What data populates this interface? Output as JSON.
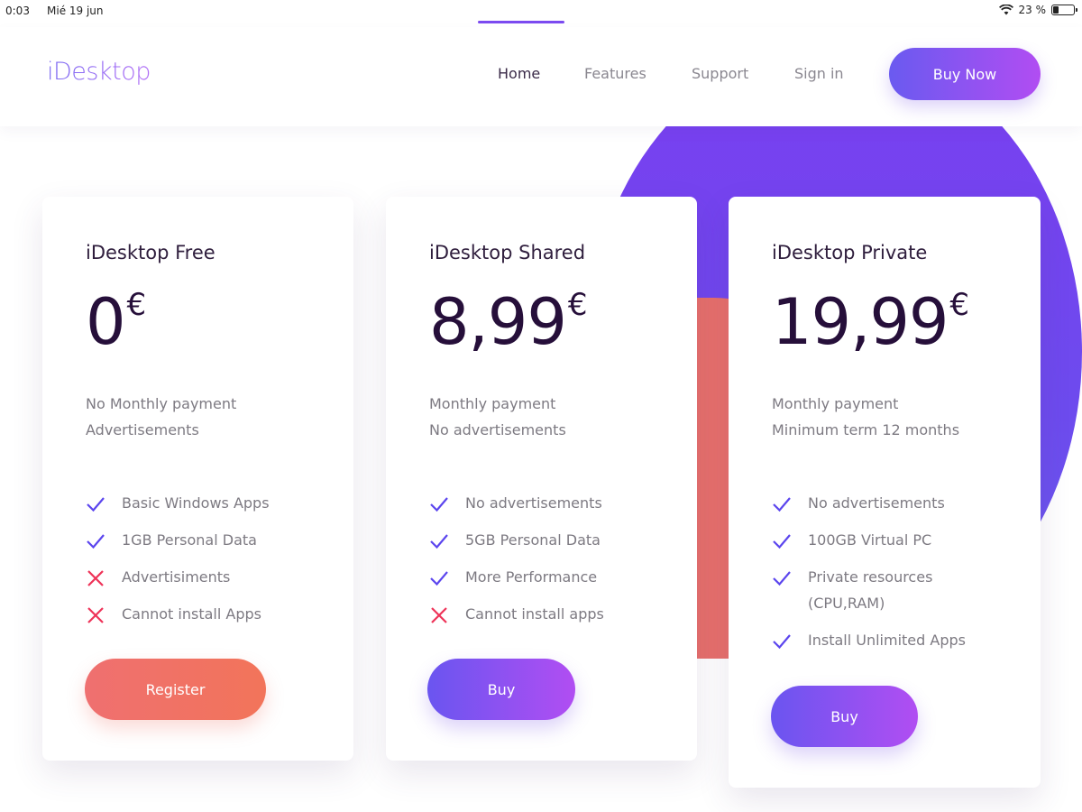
{
  "status_bar": {
    "time": "0:03",
    "date": "Mié 19 jun",
    "battery": "23 %",
    "battery_level": 0.23
  },
  "header": {
    "logo": "iDesktop",
    "nav": [
      {
        "label": "Home",
        "active": true
      },
      {
        "label": "Features",
        "active": false
      },
      {
        "label": "Support",
        "active": false
      },
      {
        "label": "Sign in",
        "active": false
      }
    ],
    "buy_now": "Buy Now"
  },
  "plans": [
    {
      "name": "iDesktop Free",
      "price": "0",
      "currency": "€",
      "description": [
        "No Monthly payment",
        "Advertisements"
      ],
      "features": [
        {
          "label": "Basic Windows Apps",
          "included": true
        },
        {
          "label": "1GB Personal Data",
          "included": true
        },
        {
          "label": "Advertisiments",
          "included": false
        },
        {
          "label": "Cannot install Apps",
          "included": false
        }
      ],
      "button": "Register"
    },
    {
      "name": "iDesktop Shared",
      "price": "8,99",
      "currency": "€",
      "description": [
        "Monthly payment",
        "No advertisements"
      ],
      "features": [
        {
          "label": "No advertisements",
          "included": true
        },
        {
          "label": "5GB Personal Data",
          "included": true
        },
        {
          "label": "More Performance",
          "included": true
        },
        {
          "label": "Cannot install apps",
          "included": false
        }
      ],
      "button": "Buy"
    },
    {
      "name": "iDesktop Private",
      "price": "19,99",
      "currency": "€",
      "description": [
        "Monthly payment",
        "Minimum term 12 months"
      ],
      "features": [
        {
          "label": "No advertisements",
          "included": true
        },
        {
          "label": "100GB Virtual PC",
          "included": true
        },
        {
          "label": "Private resources (CPU,RAM)",
          "included": true
        },
        {
          "label": "Install Unlimited Apps",
          "included": true
        }
      ],
      "button": "Buy"
    }
  ],
  "colors": {
    "check": "#5b45ee",
    "cross": "#ee3358",
    "accent_violet": "#6a55f0",
    "accent_coral": "#ef7070"
  }
}
